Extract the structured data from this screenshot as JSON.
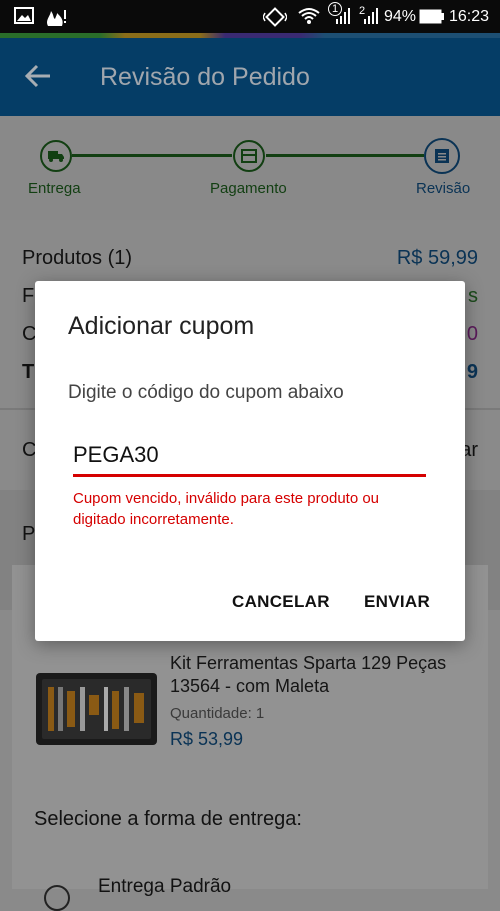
{
  "status_bar": {
    "sim1": "1",
    "sim2": "2",
    "battery": "94%",
    "time": "16:23",
    "icons": [
      "image-icon",
      "fire-alert-icon",
      "vibrate-icon",
      "wifi-icon",
      "signal-sim1-icon",
      "signal-sim2-icon",
      "battery-icon"
    ]
  },
  "header": {
    "title": "Revisão do Pedido",
    "back_icon": "arrow-left-icon"
  },
  "stepper": {
    "steps": [
      {
        "label": "Entrega",
        "icon": "truck-icon"
      },
      {
        "label": "Pagamento",
        "icon": "card-icon"
      },
      {
        "label": "Revisão",
        "icon": "list-icon"
      }
    ]
  },
  "summary": {
    "products_label": "Produtos (1)",
    "products_value": "R$ 59,99",
    "row2_label_fragment": "F",
    "row2_value_fragment": "s",
    "row3_label_fragment": "C",
    "row3_value_fragment": "0",
    "row4_label_fragment": "T",
    "row4_value_fragment": "9",
    "coupon_row_label_fragment": "C",
    "coupon_row_action_fragment": "ar",
    "section_label_fragment": "P"
  },
  "product": {
    "name": "Kit Ferramentas Sparta 129 Peças 13564 - com Maleta",
    "quantity_label": "Quantidade:",
    "quantity_value": "1",
    "price": "R$ 53,99"
  },
  "shipping": {
    "heading": "Selecione a forma de entrega:",
    "option_fragment": "Entrega Padrão"
  },
  "dialog": {
    "title": "Adicionar cupom",
    "message": "Digite o código do cupom abaixo",
    "coupon_value": "PEGA30",
    "error": "Cupom vencido, inválido para este produto ou digitado incorretamente.",
    "cancel_label": "CANCELAR",
    "submit_label": "ENVIAR"
  },
  "colors": {
    "error": "#d50000",
    "header_bg": "#053d66",
    "stepper_line": "#123f12",
    "price_blue": "#0a3355"
  }
}
